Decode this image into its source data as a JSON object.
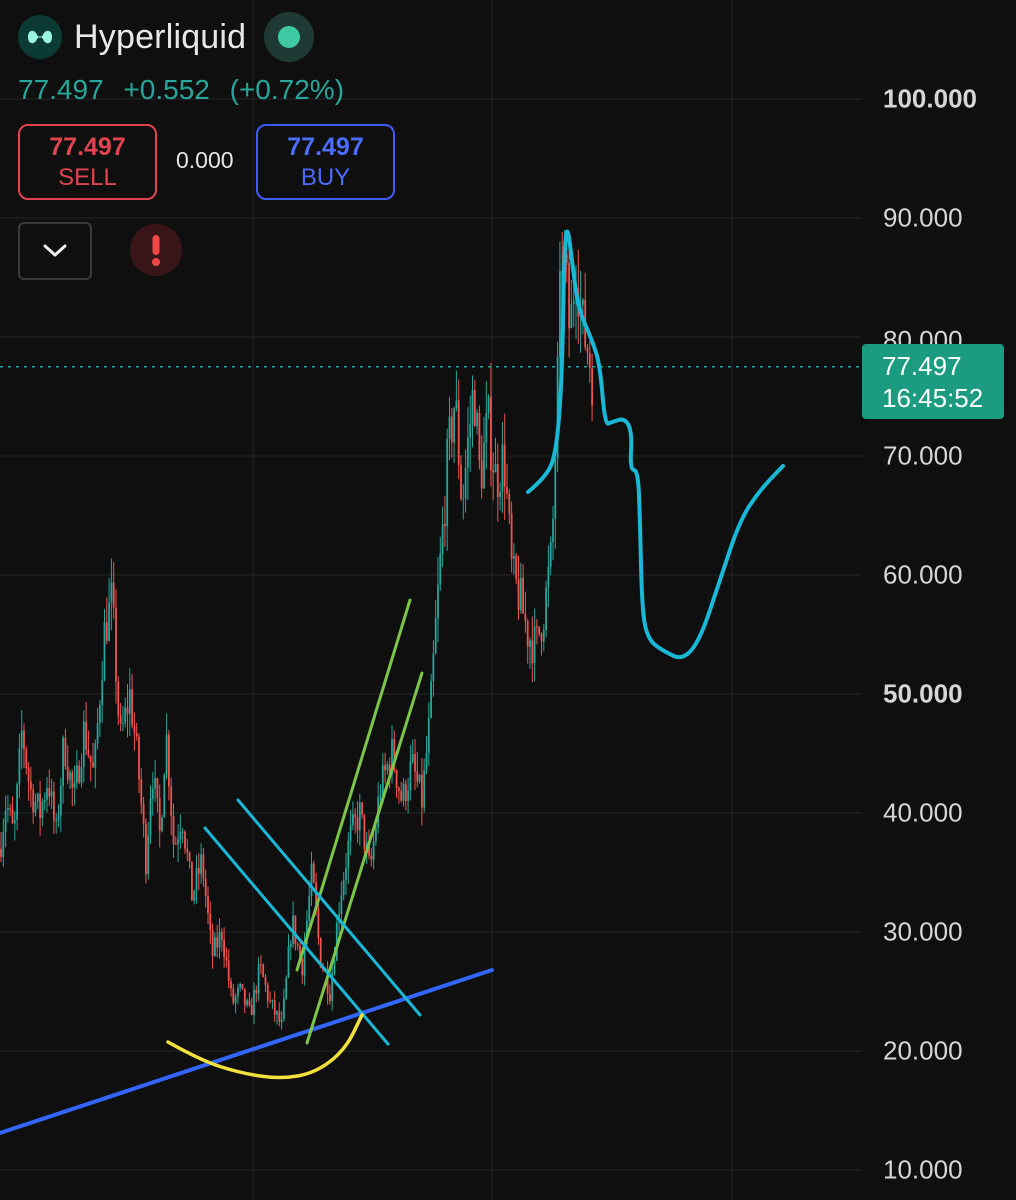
{
  "header": {
    "title": "Hyperliquid",
    "price": "77.497",
    "change": "+0.552",
    "change_pct": "(+0.72%)"
  },
  "trade": {
    "sell_price": "77.497",
    "sell_label": "SELL",
    "spread": "0.000",
    "buy_price": "77.497",
    "buy_label": "BUY"
  },
  "icons": [
    "hyperliquid-logo-icon",
    "live-dot-icon",
    "chevron-down-icon",
    "alert-icon"
  ],
  "colors": {
    "background": "#0f0f0f",
    "up": "#26a69a",
    "down": "#ef5350",
    "sell": "#e0454f",
    "buy": "#3d5cff",
    "price_tag": "#1b9b80",
    "drawing_cyan": "#19b8d6",
    "drawing_green": "#7cc44a",
    "drawing_yellow": "#f2e13c",
    "drawing_blue": "#3366ff"
  },
  "price_tag": {
    "price": "77.497",
    "countdown": "16:45:52"
  },
  "chart_data": {
    "type": "candlestick",
    "y_ticks": [
      {
        "value": 100,
        "label": "100.000",
        "bold": true
      },
      {
        "value": 90,
        "label": "90.000",
        "bold": false
      },
      {
        "value": 80,
        "label": "80.000",
        "bold": false
      },
      {
        "value": 70,
        "label": "70.000",
        "bold": false
      },
      {
        "value": 60,
        "label": "60.000",
        "bold": false
      },
      {
        "value": 50,
        "label": "50.000",
        "bold": true
      },
      {
        "value": 40,
        "label": "40.000",
        "bold": false
      },
      {
        "value": 30,
        "label": "30.000",
        "bold": false
      },
      {
        "value": 20,
        "label": "20.000",
        "bold": false
      },
      {
        "value": 10,
        "label": "10.000",
        "bold": false
      }
    ],
    "ylim": [
      10,
      100
    ],
    "grid": true,
    "current_price": 77.497,
    "price_path": [
      [
        0,
        37
      ],
      [
        6,
        41
      ],
      [
        14,
        38
      ],
      [
        22,
        47
      ],
      [
        30,
        42
      ],
      [
        40,
        40
      ],
      [
        48,
        43
      ],
      [
        56,
        38
      ],
      [
        64,
        46
      ],
      [
        74,
        41
      ],
      [
        84,
        47
      ],
      [
        94,
        43
      ],
      [
        104,
        55
      ],
      [
        112,
        58
      ],
      [
        120,
        46
      ],
      [
        130,
        50
      ],
      [
        138,
        44
      ],
      [
        146,
        36
      ],
      [
        152,
        44
      ],
      [
        160,
        38
      ],
      [
        166,
        47
      ],
      [
        174,
        37
      ],
      [
        182,
        40
      ],
      [
        192,
        33
      ],
      [
        202,
        36
      ],
      [
        212,
        28
      ],
      [
        222,
        30
      ],
      [
        232,
        24
      ],
      [
        240,
        25
      ],
      [
        250,
        23
      ],
      [
        260,
        27
      ],
      [
        270,
        24
      ],
      [
        282,
        22
      ],
      [
        292,
        31
      ],
      [
        302,
        27
      ],
      [
        312,
        35
      ],
      [
        320,
        28
      ],
      [
        330,
        25
      ],
      [
        340,
        33
      ],
      [
        350,
        38
      ],
      [
        360,
        40
      ],
      [
        370,
        35
      ],
      [
        380,
        42
      ],
      [
        392,
        45
      ],
      [
        402,
        41
      ],
      [
        412,
        44
      ],
      [
        422,
        41
      ],
      [
        430,
        48
      ],
      [
        436,
        56
      ],
      [
        442,
        63
      ],
      [
        448,
        70
      ],
      [
        455,
        75
      ],
      [
        462,
        66
      ],
      [
        468,
        71
      ],
      [
        474,
        76
      ],
      [
        480,
        68
      ],
      [
        488,
        73
      ],
      [
        496,
        68
      ],
      [
        504,
        70
      ],
      [
        512,
        60
      ],
      [
        520,
        58
      ],
      [
        528,
        55
      ],
      [
        536,
        54
      ],
      [
        544,
        57
      ],
      [
        552,
        62
      ],
      [
        556,
        72
      ],
      [
        560,
        83
      ],
      [
        565,
        86
      ],
      [
        570,
        80
      ],
      [
        576,
        87
      ],
      [
        582,
        81
      ],
      [
        588,
        79
      ],
      [
        594,
        76
      ]
    ],
    "drawings": {
      "projection_cyan": [
        [
          528,
          492
        ],
        [
          545,
          478
        ],
        [
          556,
          455
        ],
        [
          562,
          380
        ],
        [
          564,
          260
        ],
        [
          567,
          222
        ],
        [
          572,
          260
        ],
        [
          578,
          308
        ],
        [
          592,
          340
        ],
        [
          600,
          365
        ],
        [
          605,
          425
        ],
        [
          612,
          422
        ],
        [
          625,
          418
        ],
        [
          632,
          432
        ],
        [
          630,
          470
        ],
        [
          638,
          470
        ],
        [
          640,
          520
        ],
        [
          642,
          610
        ],
        [
          648,
          640
        ],
        [
          665,
          652
        ],
        [
          683,
          660
        ],
        [
          700,
          640
        ],
        [
          720,
          580
        ],
        [
          740,
          520
        ],
        [
          760,
          490
        ],
        [
          783,
          466
        ]
      ],
      "channel_cyan": [
        [
          [
            205,
            828
          ],
          [
            388,
            1044
          ]
        ],
        [
          [
            238,
            800
          ],
          [
            420,
            1015
          ]
        ]
      ],
      "channel_green": [
        [
          [
            297,
            970
          ],
          [
            410,
            600
          ]
        ],
        [
          [
            307,
            1043
          ],
          [
            422,
            673
          ]
        ]
      ],
      "support_blue": [
        [
          0,
          1133
        ],
        [
          492,
          970
        ]
      ],
      "cup_yellow": [
        [
          168,
          1042
        ],
        [
          200,
          1060
        ],
        [
          240,
          1073
        ],
        [
          280,
          1079
        ],
        [
          315,
          1073
        ],
        [
          345,
          1050
        ],
        [
          362,
          1015
        ]
      ]
    }
  }
}
